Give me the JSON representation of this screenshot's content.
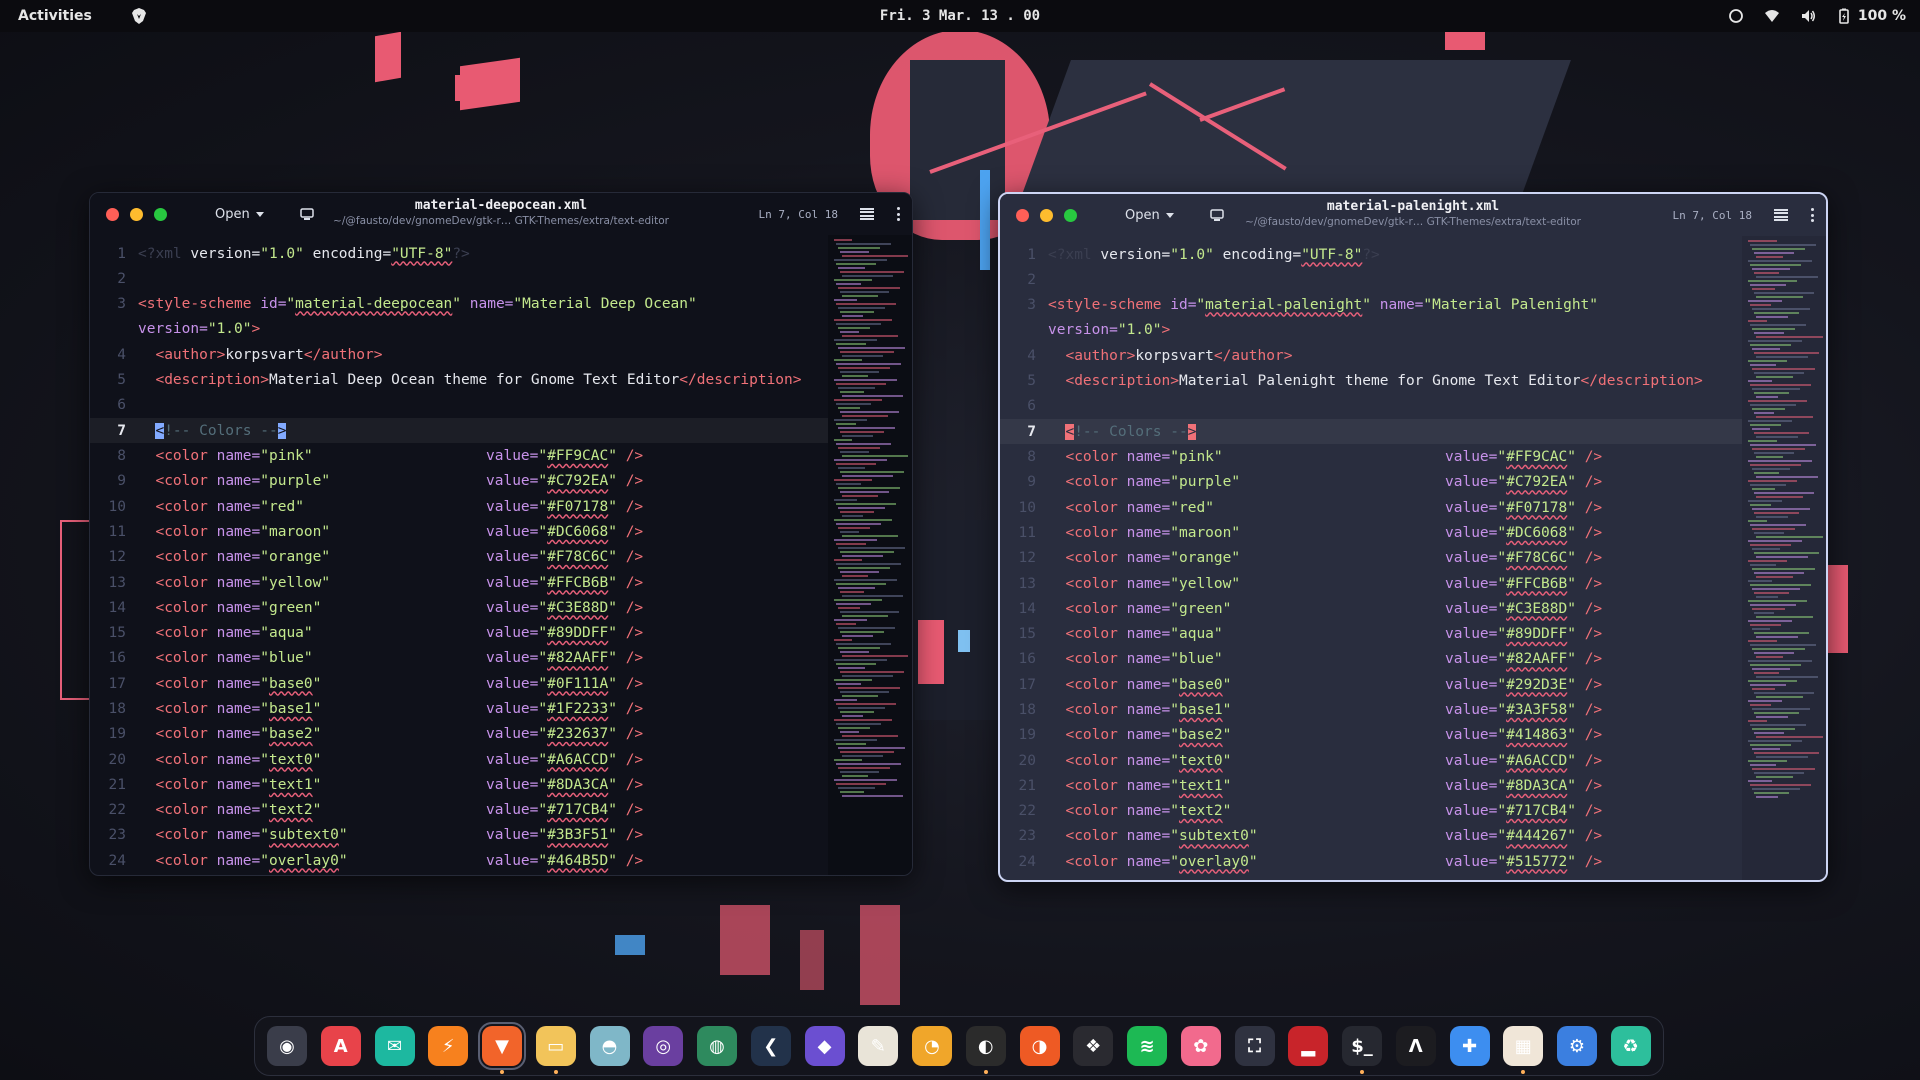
{
  "topbar": {
    "activities": "Activities",
    "clock": "Fri. 3 Mar.  13 . 00",
    "battery": "100 %"
  },
  "colors": {
    "tag": "#F07178",
    "attr": "#C792EA",
    "string": "#C3E88D",
    "deepocean_bg": "#0F111A",
    "palenight_bg": "#292D3E"
  },
  "windows": {
    "left": {
      "open_label": "Open",
      "title": "material-deepocean.xml",
      "path": "~/@fausto/dev/gnomeDev/gtk-r… GTK-Themes/extra/text-editor",
      "position": "Ln 7, Col 18",
      "scheme_id": "material-deepocean",
      "scheme_name": "Material Deep Ocean",
      "author": "korpsvart",
      "description": "Material Deep Ocean theme for Gnome Text Editor",
      "colors": [
        [
          "pink",
          "#FF9CAC"
        ],
        [
          "purple",
          "#C792EA"
        ],
        [
          "red",
          "#F07178"
        ],
        [
          "maroon",
          "#DC6068"
        ],
        [
          "orange",
          "#F78C6C"
        ],
        [
          "yellow",
          "#FFCB6B"
        ],
        [
          "green",
          "#C3E88D"
        ],
        [
          "aqua",
          "#89DDFF"
        ],
        [
          "blue",
          "#82AAFF"
        ],
        [
          "base0",
          "#0F111A"
        ],
        [
          "base1",
          "#1F2233"
        ],
        [
          "base2",
          "#232637"
        ],
        [
          "text0",
          "#A6ACCD"
        ],
        [
          "text1",
          "#8DA3CA"
        ],
        [
          "text2",
          "#717CB4"
        ],
        [
          "subtext0",
          "#3B3F51"
        ],
        [
          "overlay0",
          "#464B5D"
        ]
      ]
    },
    "right": {
      "open_label": "Open",
      "title": "material-palenight.xml",
      "path": "~/@fausto/dev/gnomeDev/gtk-r… GTK-Themes/extra/text-editor",
      "position": "Ln 7, Col 18",
      "scheme_id": "material-palenight",
      "scheme_name": "Material Palenight",
      "author": "korpsvart",
      "description": "Material Palenight theme for Gnome Text Editor",
      "colors": [
        [
          "pink",
          "#FF9CAC"
        ],
        [
          "purple",
          "#C792EA"
        ],
        [
          "red",
          "#F07178"
        ],
        [
          "maroon",
          "#DC6068"
        ],
        [
          "orange",
          "#F78C6C"
        ],
        [
          "yellow",
          "#FFCB6B"
        ],
        [
          "green",
          "#C3E88D"
        ],
        [
          "aqua",
          "#89DDFF"
        ],
        [
          "blue",
          "#82AAFF"
        ],
        [
          "base0",
          "#292D3E"
        ],
        [
          "base1",
          "#3A3F58"
        ],
        [
          "base2",
          "#414863"
        ],
        [
          "text0",
          "#A6ACCD"
        ],
        [
          "text1",
          "#8DA3CA"
        ],
        [
          "text2",
          "#717CB4"
        ],
        [
          "subtext0",
          "#444267"
        ],
        [
          "overlay0",
          "#515772"
        ]
      ]
    }
  },
  "code_common": {
    "xml_decl_open": "<?xml",
    "xml_decl_attrs_a": " version=",
    "xml_version": "\"1.0\"",
    "xml_decl_attrs_b": " encoding=",
    "xml_encoding": "\"UTF-8\"",
    "xml_decl_close": "?>",
    "comment_open": "<",
    "comment_body": "!-- Colors --",
    "comment_close": ">"
  },
  "dock": {
    "items": [
      {
        "name": "ubuntu-avatar-icon",
        "color": "#3a3d4a",
        "glyph": "◉"
      },
      {
        "name": "app-center-icon",
        "color": "#e8434a",
        "glyph": "A"
      },
      {
        "name": "mail-icon",
        "color": "#1db8a0",
        "glyph": "✉"
      },
      {
        "name": "flash-icon",
        "color": "#f7811e",
        "glyph": "⚡"
      },
      {
        "name": "brave-icon",
        "color": "#f2642a",
        "glyph": "▼"
      },
      {
        "name": "files-icon",
        "color": "#f2c45a",
        "glyph": "▭"
      },
      {
        "name": "disk-icon",
        "color": "#7fb7c8",
        "glyph": "◓"
      },
      {
        "name": "github-icon",
        "color": "#6a3fa0",
        "glyph": "◎"
      },
      {
        "name": "globe-icon",
        "color": "#2e8a5e",
        "glyph": "◍"
      },
      {
        "name": "vscode-icon",
        "color": "#22324a",
        "glyph": "❮"
      },
      {
        "name": "obsidian-icon",
        "color": "#6b4fd1",
        "glyph": "◆"
      },
      {
        "name": "text-editor-icon",
        "color": "#e9e4d8",
        "glyph": "✎"
      },
      {
        "name": "color-picker-icon",
        "color": "#f0a62a",
        "glyph": "◔"
      },
      {
        "name": "figma-icon",
        "color": "#2b2b2b",
        "glyph": "◐"
      },
      {
        "name": "palette-icon",
        "color": "#ee5a24",
        "glyph": "◑"
      },
      {
        "name": "extension-icon",
        "color": "#2a2a30",
        "glyph": "❖"
      },
      {
        "name": "spotify-icon",
        "color": "#1db954",
        "glyph": "≋"
      },
      {
        "name": "pinwheel-icon",
        "color": "#f26a8d",
        "glyph": "✿"
      },
      {
        "name": "screenshot-icon",
        "color": "#2f3240",
        "glyph": "⛶"
      },
      {
        "name": "audio-icon",
        "color": "#c8242a",
        "glyph": "▂"
      },
      {
        "name": "terminal-icon",
        "color": "#262830",
        "glyph": "$_"
      },
      {
        "name": "anytype-icon",
        "color": "#1c1c20",
        "glyph": "Λ"
      },
      {
        "name": "puzzle-icon",
        "color": "#3d8ef0",
        "glyph": "✚"
      },
      {
        "name": "tweaks-icon",
        "color": "#f0e6d8",
        "glyph": "▦"
      },
      {
        "name": "settings-icon",
        "color": "#3b7fe0",
        "glyph": "⚙"
      },
      {
        "name": "trash-icon",
        "color": "#2dbf9c",
        "glyph": "♻"
      }
    ]
  }
}
